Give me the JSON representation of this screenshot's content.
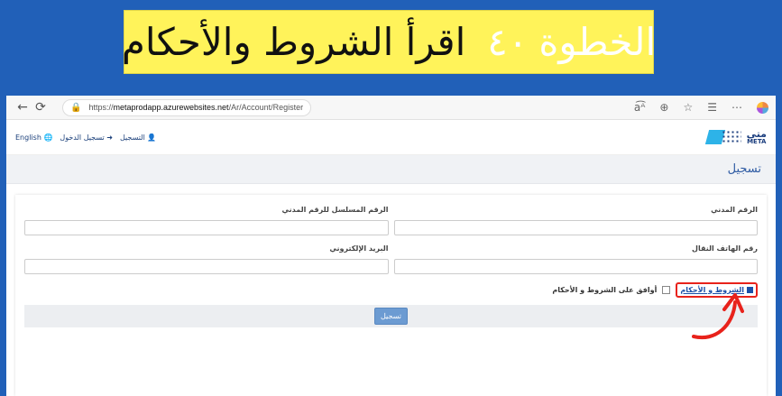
{
  "banner": {
    "step_label": "الخطوة",
    "step_number": "٤٠",
    "instruction": "اقرأ الشروط والأحكام"
  },
  "browser": {
    "url_prefix": "https://",
    "url_host": "metaprodapp.azurewebsites.net",
    "url_path": "/Ar/Account/Register"
  },
  "header": {
    "english_label": "English",
    "login_label": "تسجيل الدخول",
    "register_label": "التسجيل",
    "logo_text_ar": "متى",
    "logo_text_en": "META"
  },
  "page": {
    "title": "تسجيل"
  },
  "form": {
    "civil_id_label": "الرقم المدني",
    "serial_label": "الرقم المسلسل للرقم المدني",
    "mobile_label": "رقم الهاتف النقال",
    "email_label": "البريد الإلكتروني",
    "terms_link": "الشروط و الأحكام",
    "agree_label": "أوافق على الشروط و الأحكام",
    "submit_label": "تسجيل"
  }
}
